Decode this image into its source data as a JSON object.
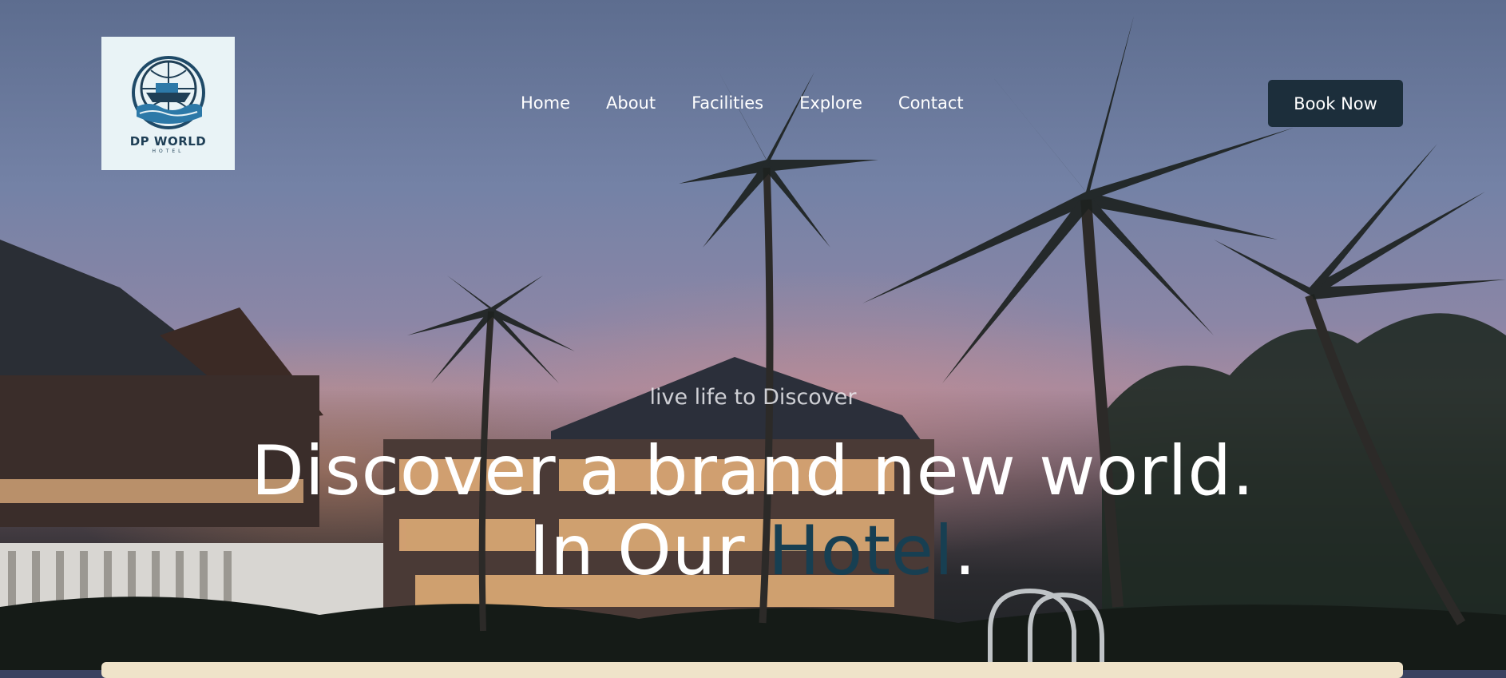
{
  "logo": {
    "name": "DP WORLD",
    "sub": "HOTEL"
  },
  "nav": {
    "items": [
      {
        "label": "Home"
      },
      {
        "label": "About"
      },
      {
        "label": "Facilities"
      },
      {
        "label": "Explore"
      },
      {
        "label": "Contact"
      }
    ]
  },
  "header": {
    "book_label": "Book Now"
  },
  "hero": {
    "tagline": "live life to Discover",
    "line1": "Discover a brand new world.",
    "line2_prefix": "In Our ",
    "line2_accent": "Hotel",
    "line2_suffix": "."
  },
  "colors": {
    "accent": "#173f52",
    "button": "#1c2e3b",
    "bottom_bar": "#efe3c9"
  }
}
